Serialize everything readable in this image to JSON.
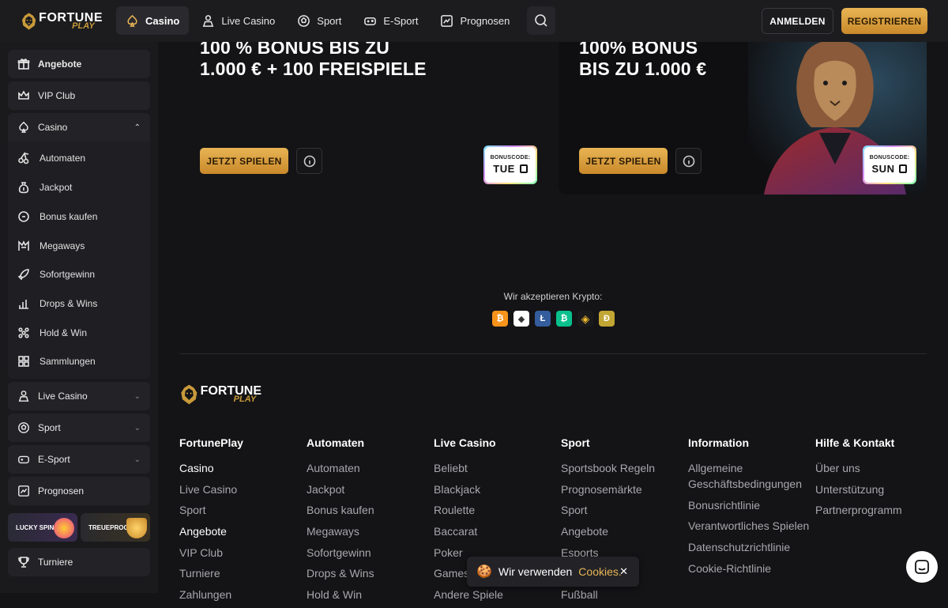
{
  "header": {
    "logo_text": "FORTUNE",
    "logo_sub": "PLAY",
    "nav": [
      {
        "label": "Casino",
        "icon": "casino-icon",
        "active": true
      },
      {
        "label": "Live Casino",
        "icon": "dealer-icon"
      },
      {
        "label": "Sport",
        "icon": "soccer-ball-icon"
      },
      {
        "label": "E-Sport",
        "icon": "gamepad-icon"
      },
      {
        "label": "Prognosen",
        "icon": "chart-icon"
      }
    ],
    "login_label": "ANMELDEN",
    "register_label": "REGISTRIEREN"
  },
  "sidebar": {
    "top_items": [
      {
        "label": "Angebote",
        "icon": "gift-icon"
      },
      {
        "label": "VIP Club",
        "icon": "crown-icon"
      },
      {
        "label": "Casino",
        "icon": "casino-icon",
        "expanded": true
      }
    ],
    "casino_sub": [
      {
        "label": "Automaten",
        "icon": "cherries-icon"
      },
      {
        "label": "Jackpot",
        "icon": "money-bag-icon"
      },
      {
        "label": "Bonus kaufen",
        "icon": "coin-icon"
      },
      {
        "label": "Megaways",
        "icon": "megaways-icon"
      },
      {
        "label": "Sofortgewinn",
        "icon": "rocket-icon"
      },
      {
        "label": "Drops & Wins",
        "icon": "drops-icon"
      },
      {
        "label": "Hold & Win",
        "icon": "grid-dots-icon"
      },
      {
        "label": "Sammlungen",
        "icon": "collections-icon"
      }
    ],
    "bottom_items": [
      {
        "label": "Live Casino",
        "icon": "dealer-icon",
        "chevron": true
      },
      {
        "label": "Sport",
        "icon": "soccer-ball-icon",
        "chevron": true
      },
      {
        "label": "E-Sport",
        "icon": "gamepad-icon",
        "chevron": true
      },
      {
        "label": "Prognosen",
        "icon": "chart-icon"
      }
    ],
    "promos": [
      {
        "label": "LUCKY SPIN"
      },
      {
        "label": "TREUEPROG"
      }
    ],
    "turniere": {
      "label": "Turniere",
      "icon": "trophy-icon"
    }
  },
  "banners": [
    {
      "title_line1": "100 % BONUS BIS ZU",
      "title_line2": "1.000 € + 100 FREISPIELE",
      "play_label": "JETZT SPIELEN",
      "code_label": "BONUSCODE:",
      "code": "TUE"
    },
    {
      "title_line1": "100% BONUS",
      "title_line2": "BIS ZU 1.000 €",
      "play_label": "JETZT SPIELEN",
      "code_label": "BONUSCODE:",
      "code": "SUN"
    }
  ],
  "crypto": {
    "label": "Wir akzeptieren Krypto:",
    "coins": [
      {
        "icon": "bitcoin-icon",
        "glyph": "₿",
        "color": "#f7931a"
      },
      {
        "icon": "ethereum-icon",
        "glyph": "◆",
        "color": "#ffffff"
      },
      {
        "icon": "litecoin-icon",
        "glyph": "Ł",
        "color": "#345d9d"
      },
      {
        "icon": "bitcoin-cash-icon",
        "glyph": "₿",
        "color": "#0ac18e"
      },
      {
        "icon": "binance-icon",
        "glyph": "◈",
        "color": "#1a1a1d"
      },
      {
        "icon": "dogecoin-icon",
        "glyph": "Ð",
        "color": "#c2a633"
      }
    ]
  },
  "footer": {
    "columns": [
      {
        "heading": "FortunePlay",
        "links": [
          "Casino",
          "Live Casino",
          "Sport",
          "Angebote",
          "VIP Club",
          "Turniere",
          "Zahlungen"
        ]
      },
      {
        "heading": "Automaten",
        "links": [
          "Automaten",
          "Jackpot",
          "Bonus kaufen",
          "Megaways",
          "Sofortgewinn",
          "Drops & Wins",
          "Hold & Win"
        ]
      },
      {
        "heading": "Live Casino",
        "links": [
          "Beliebt",
          "Blackjack",
          "Roulette",
          "Baccarat",
          "Poker",
          "Games",
          "Andere Spiele"
        ]
      },
      {
        "heading": "Sport",
        "links": [
          "Sportsbook Regeln",
          "Prognosemärkte",
          "Sport",
          "Angebote",
          "Esports",
          "",
          "Fußball"
        ]
      },
      {
        "heading": "Information",
        "links": [
          "Allgemeine Geschäftsbedingungen",
          "Bonusrichtlinie",
          "Verantwortliches Spielen",
          "Datenschutzrichtlinie",
          "Cookie-Richtlinie"
        ]
      },
      {
        "heading": "Hilfe & Kontakt",
        "links": [
          "Über uns",
          "Unterstützung",
          "Partnerprogramm"
        ]
      }
    ]
  },
  "cookie": {
    "text": "Wir verwenden",
    "link": "Cookies."
  }
}
